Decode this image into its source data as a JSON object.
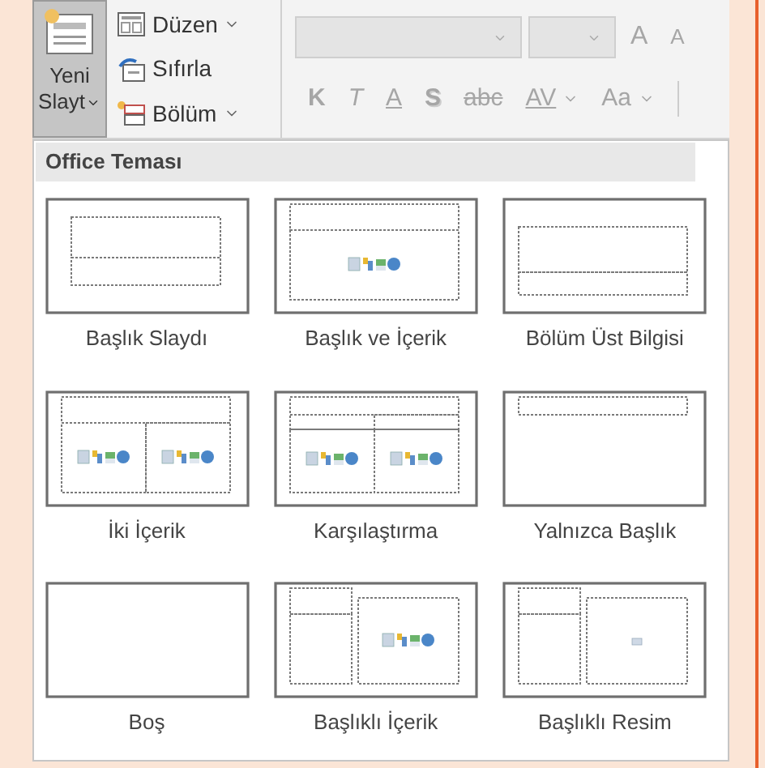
{
  "ribbon": {
    "new_slide": {
      "label": "Yeni Slayt",
      "selected": true
    },
    "commands": [
      {
        "label": "Düzen",
        "kind": "layout",
        "dropdown": true
      },
      {
        "label": "Sıfırla",
        "kind": "reset",
        "dropdown": false
      },
      {
        "label": "Bölüm",
        "kind": "section",
        "dropdown": true
      }
    ],
    "font_size_row": [
      {
        "label": "A",
        "kind": "grow"
      },
      {
        "label": "A",
        "kind": "shrink"
      }
    ],
    "format_row": [
      {
        "label": "K",
        "kind": "bold"
      },
      {
        "label": "T",
        "kind": "italic"
      },
      {
        "label": "A",
        "kind": "underline"
      },
      {
        "label": "S",
        "kind": "shadow"
      },
      {
        "label": "abc",
        "kind": "strike"
      },
      {
        "label": "AV",
        "kind": "spacing"
      },
      {
        "label": "Aa",
        "kind": "case"
      }
    ]
  },
  "gallery": {
    "header": "Office Teması",
    "layouts": [
      {
        "name": "Başlık Slaydı",
        "kind": "title"
      },
      {
        "name": "Başlık ve İçerik",
        "kind": "title-content"
      },
      {
        "name": "Bölüm Üst Bilgisi",
        "kind": "section"
      },
      {
        "name": "İki İçerik",
        "kind": "two-content"
      },
      {
        "name": "Karşılaştırma",
        "kind": "comparison"
      },
      {
        "name": "Yalnızca Başlık",
        "kind": "title-only"
      },
      {
        "name": "Boş",
        "kind": "blank"
      },
      {
        "name": "Başlıklı İçerik",
        "kind": "content-caption"
      },
      {
        "name": "Başlıklı Resim",
        "kind": "picture-caption"
      }
    ]
  }
}
